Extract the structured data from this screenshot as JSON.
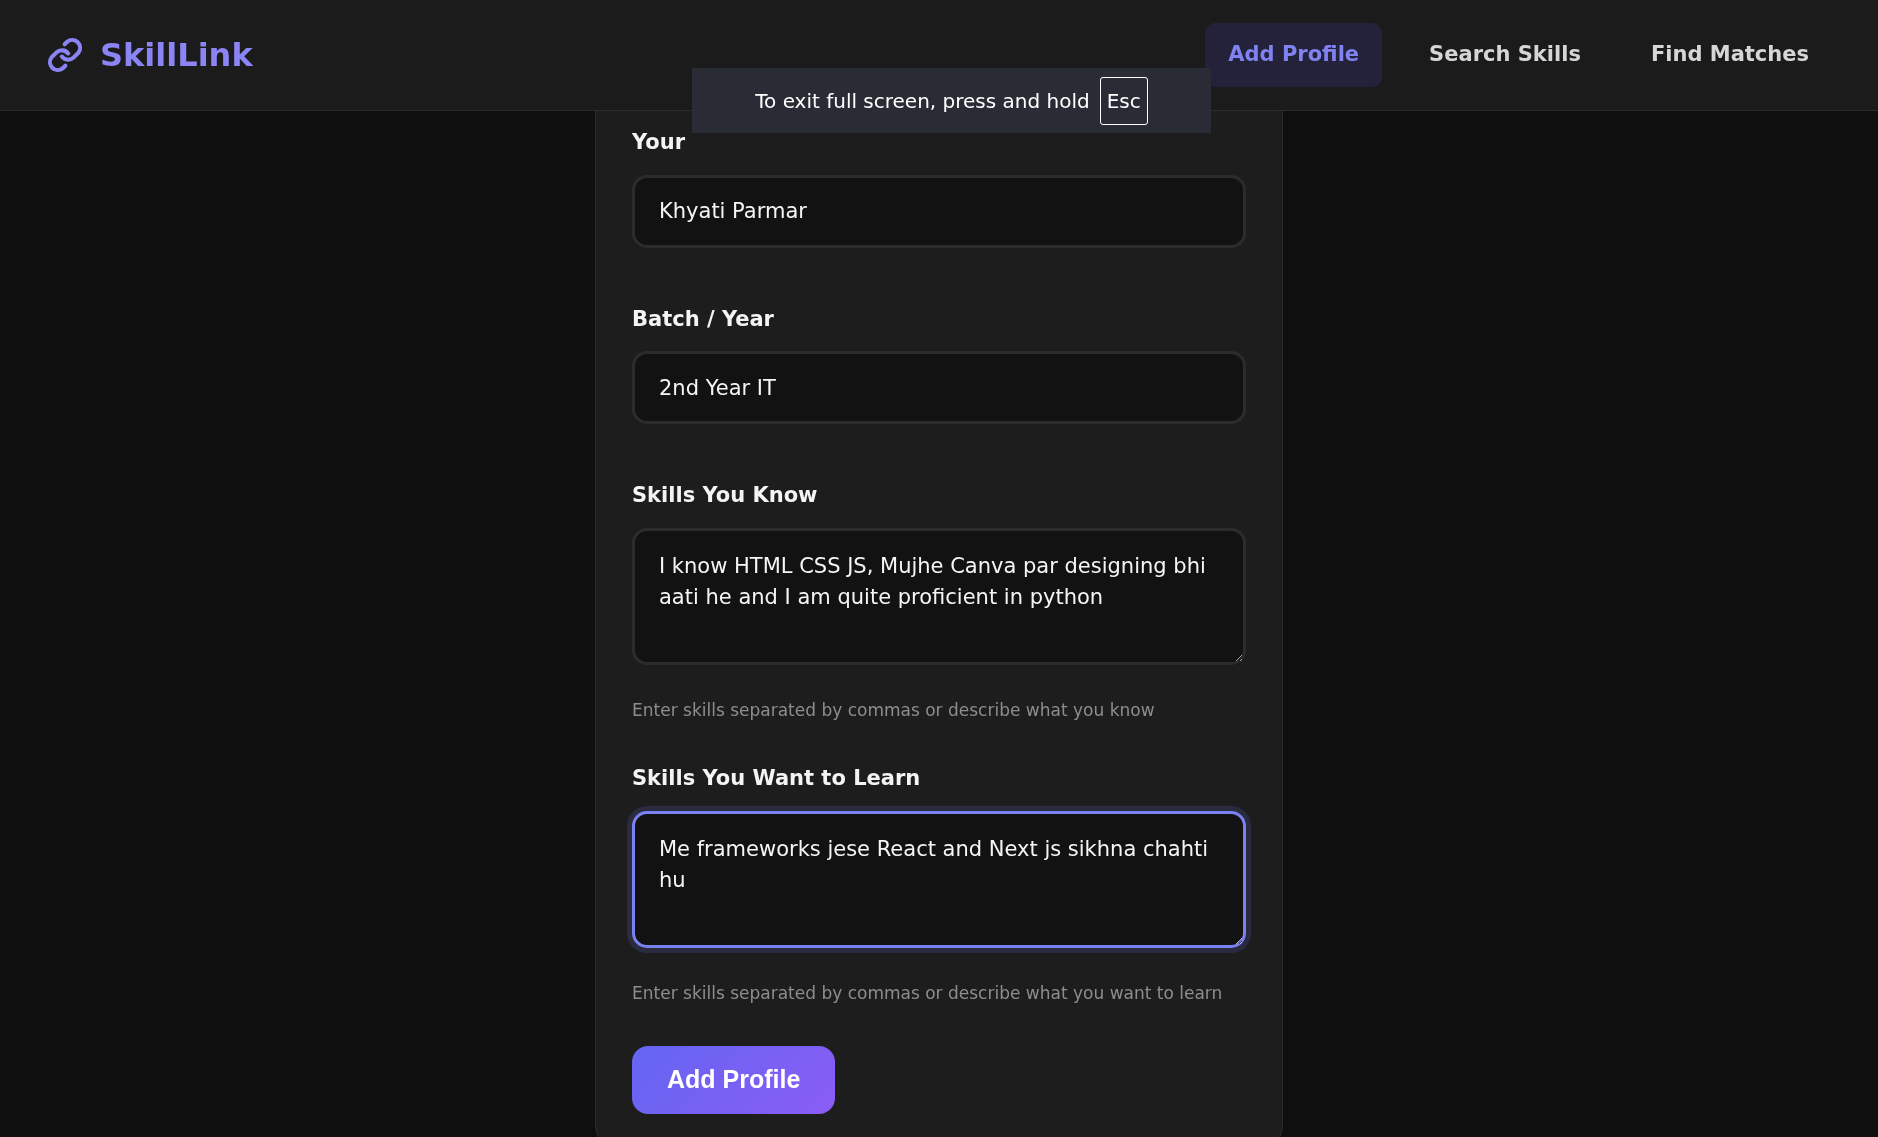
{
  "brand": {
    "name": "SkillLink"
  },
  "nav": [
    {
      "label": "Add Profile",
      "selected": true
    },
    {
      "label": "Search Skills",
      "selected": false
    },
    {
      "label": "Find Matches",
      "selected": false
    }
  ],
  "fullscreen_notice": {
    "text": "To exit full screen, press and hold",
    "key": "Esc"
  },
  "form": {
    "fields": [
      {
        "kind": "input",
        "label": "Your",
        "value": "Khyati Parmar",
        "focused": false
      },
      {
        "kind": "input",
        "label": "Batch / Year",
        "value": "2nd Year IT",
        "focused": false
      },
      {
        "kind": "textarea",
        "label": "Skills You Know",
        "value": "I know HTML CSS JS, Mujhe Canva par designing bhi aati he and I am quite proficient in python",
        "help": "Enter skills separated by commas or describe what you know",
        "focused": false
      },
      {
        "kind": "textarea",
        "label": "Skills You Want to Learn",
        "value": "Me frameworks jese React and Next js sikhna chahti hu ",
        "help": "Enter skills separated by commas or describe what you want to learn",
        "focused": true
      }
    ],
    "submit": "Add Profile"
  }
}
